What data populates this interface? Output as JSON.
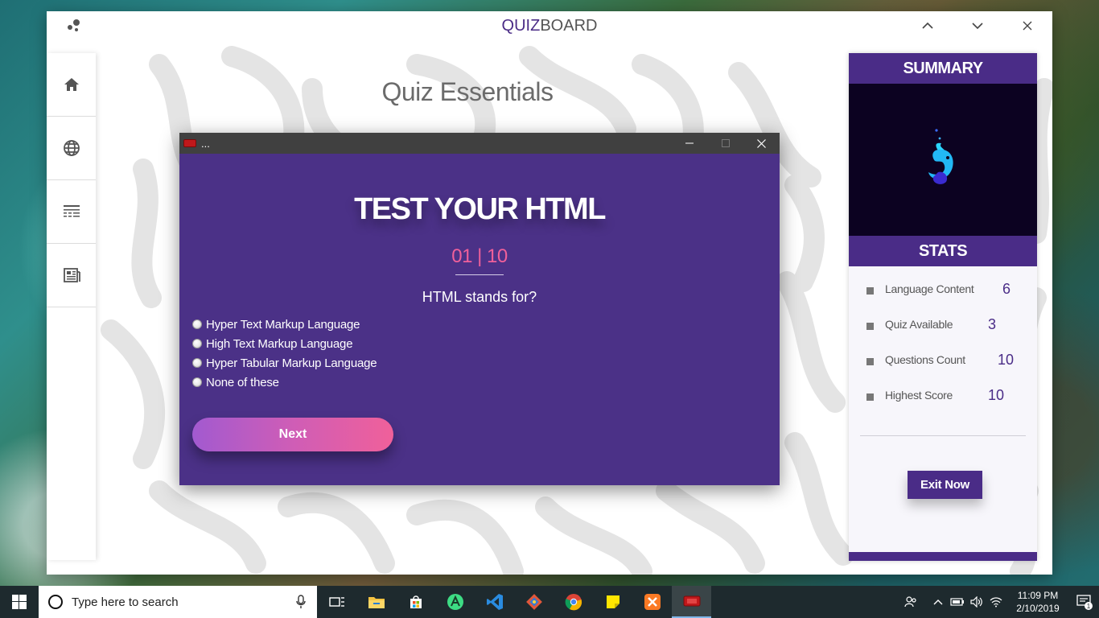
{
  "app": {
    "title_part1": "QUIZ",
    "title_part2": "BOARD",
    "page_heading": "Quiz Essentials",
    "window_controls": [
      "^",
      "v",
      "×"
    ]
  },
  "nav": {
    "items": [
      "home-icon",
      "globe-icon",
      "list-icon",
      "newspaper-icon"
    ]
  },
  "summary": {
    "title": "SUMMARY",
    "stats_title": "STATS",
    "stats": [
      {
        "label": "Language Content",
        "value": "6"
      },
      {
        "label": "Quiz Available",
        "value": "3"
      },
      {
        "label": "Questions Count",
        "value": "10"
      },
      {
        "label": "Highest Score",
        "value": "10"
      }
    ],
    "exit_label": "Exit Now"
  },
  "quiz_window": {
    "title": "...",
    "heading": "TEST YOUR HTML",
    "counter": "01 | 10",
    "question": "HTML stands for?",
    "options": [
      "Hyper Text Markup Language",
      "High Text Markup Language",
      "Hyper Tabular Markup Language",
      "None of these"
    ],
    "next_label": "Next"
  },
  "taskbar": {
    "search_placeholder": "Type here to search",
    "time": "11:09 PM",
    "date": "2/10/2019",
    "notification_count": "1",
    "pinned": [
      "task-view-icon",
      "file-explorer-icon",
      "store-icon",
      "android-studio-icon",
      "vscode-icon",
      "git-icon",
      "chrome-icon",
      "sticky-notes-icon",
      "xampp-icon",
      "quiz-app-icon"
    ]
  },
  "colors": {
    "brand_purple": "#4a2c87",
    "accent_pink": "#f0609a",
    "dialog_bg": "#4b3187"
  }
}
